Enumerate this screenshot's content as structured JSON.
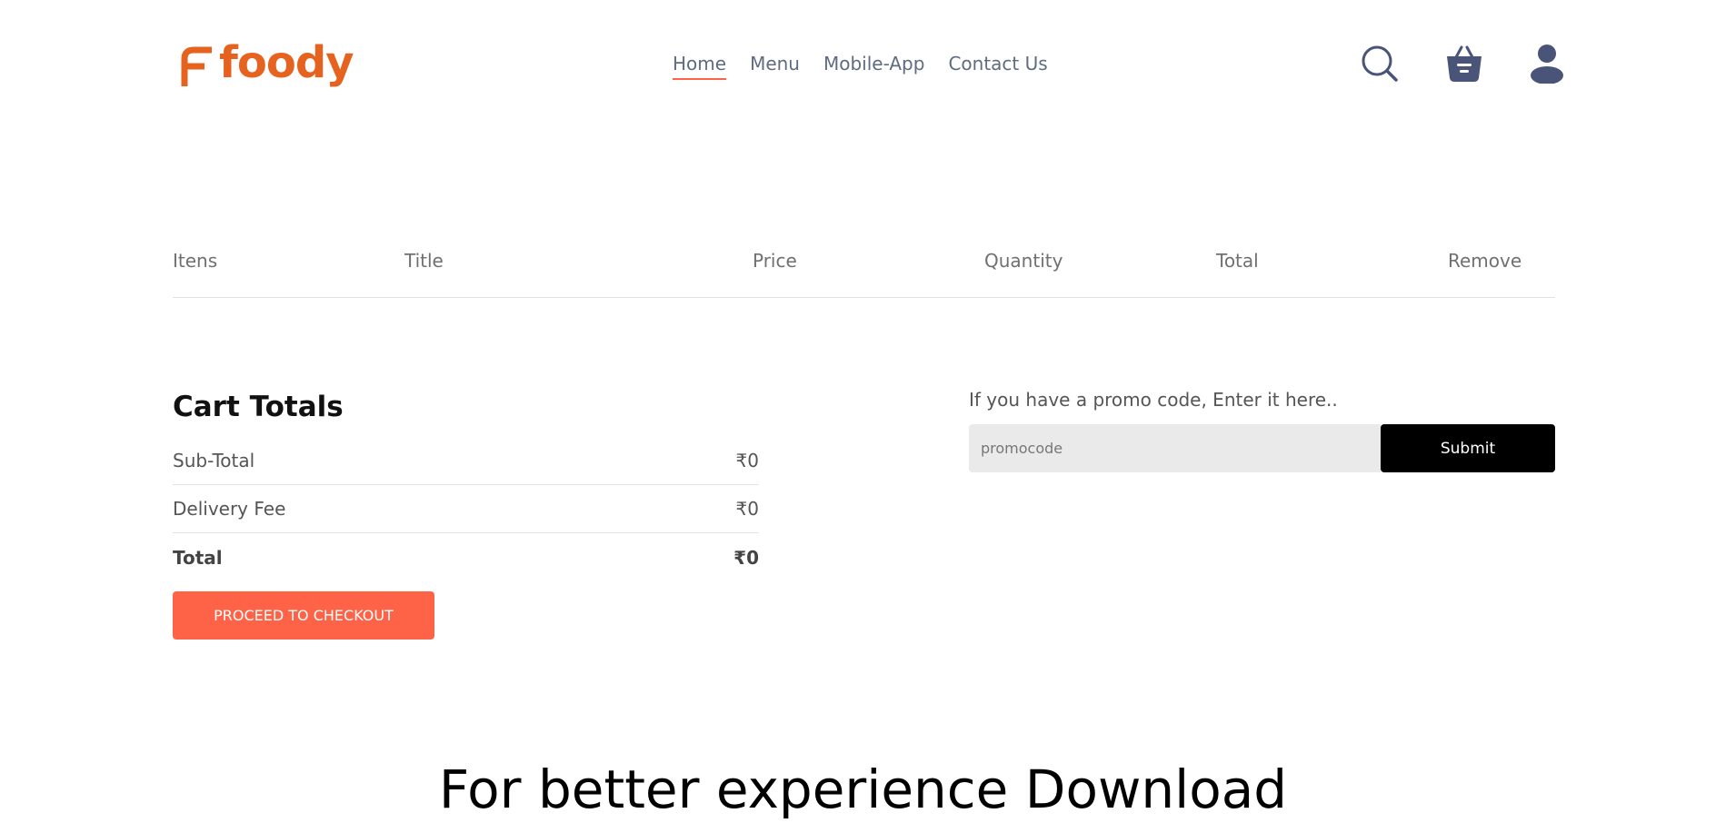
{
  "brand": {
    "name": "foody",
    "color": "#e5621f"
  },
  "nav": {
    "items": [
      {
        "label": "Home",
        "active": true
      },
      {
        "label": "Menu",
        "active": false
      },
      {
        "label": "Mobile-App",
        "active": false
      },
      {
        "label": "Contact Us",
        "active": false
      }
    ]
  },
  "header_icons": [
    "search-icon",
    "basket-icon",
    "user-icon"
  ],
  "cart_table": {
    "columns": [
      "Itens",
      "Title",
      "Price",
      "Quantity",
      "Total",
      "Remove"
    ],
    "rows": []
  },
  "cart_totals": {
    "title": "Cart Totals",
    "subtotal_label": "Sub-Total",
    "subtotal_value": "₹0",
    "delivery_label": "Delivery Fee",
    "delivery_value": "₹0",
    "total_label": "Total",
    "total_value": "₹0",
    "checkout_label": "PROCEED TO CHECKOUT"
  },
  "promo": {
    "label": "If you have a promo code, Enter it here..",
    "placeholder": "promocode",
    "submit_label": "Submit"
  },
  "download": {
    "heading": "For better experience Download"
  },
  "colors": {
    "accent": "#ff6347",
    "icon": "#4a5478",
    "nav_text": "#5f6b7f"
  }
}
